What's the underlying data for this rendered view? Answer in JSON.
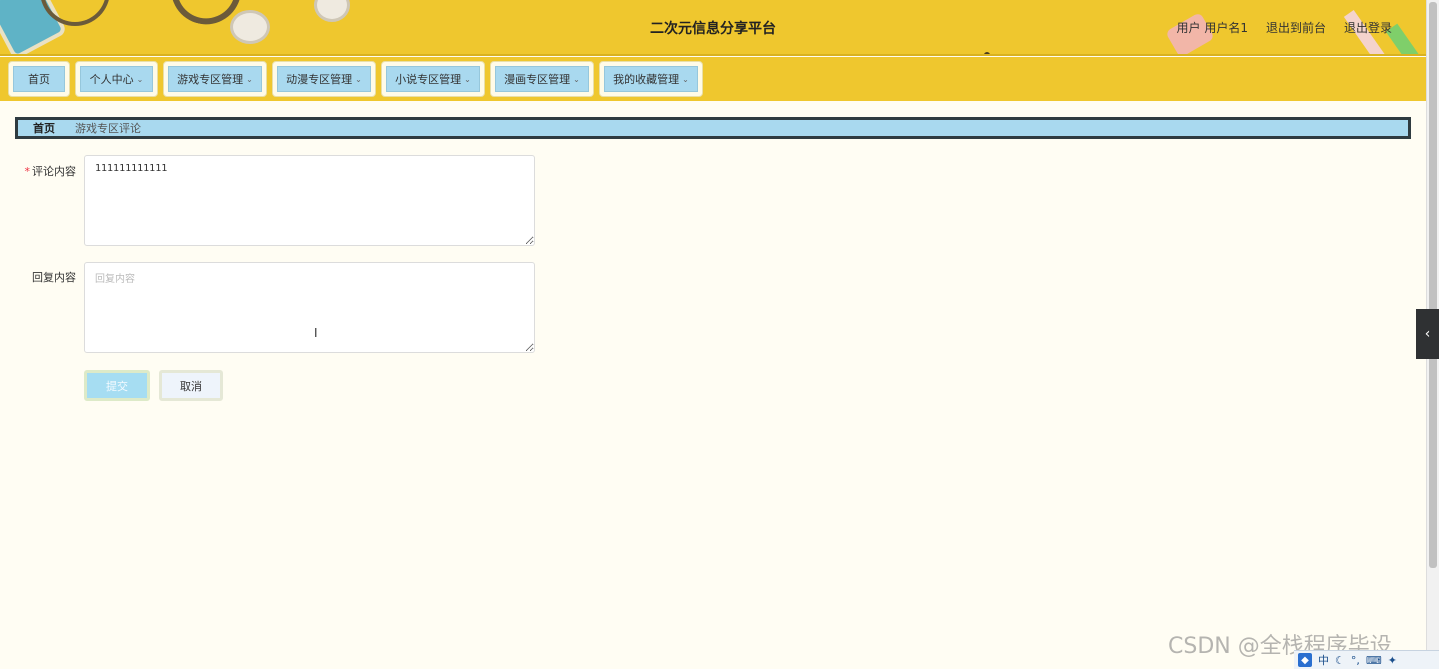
{
  "header": {
    "site_title": "二次元信息分享平台",
    "user_label": "用户",
    "username": "用户名1",
    "back_to_front": "退出到前台",
    "logout": "退出登录"
  },
  "nav": {
    "items": [
      {
        "label": "首页",
        "has_dropdown": false
      },
      {
        "label": "个人中心",
        "has_dropdown": true
      },
      {
        "label": "游戏专区管理",
        "has_dropdown": true
      },
      {
        "label": "动漫专区管理",
        "has_dropdown": true
      },
      {
        "label": "小说专区管理",
        "has_dropdown": true
      },
      {
        "label": "漫画专区管理",
        "has_dropdown": true
      },
      {
        "label": "我的收藏管理",
        "has_dropdown": true
      }
    ]
  },
  "breadcrumb": {
    "home": "首页",
    "current": "游戏专区评论"
  },
  "form": {
    "comment_label": "评论内容",
    "comment_value": "111111111111",
    "reply_label": "回复内容",
    "reply_placeholder": "回复内容",
    "submit_label": "提交",
    "cancel_label": "取消"
  },
  "watermark": "CSDN @全栈程序毕设",
  "tray": {
    "ime_label": "中"
  },
  "colors": {
    "header_bg": "#efc72e",
    "nav_button_bg": "#a9d9ef",
    "page_bg": "#fffdf3",
    "breadcrumb_border": "#2f3b40"
  }
}
